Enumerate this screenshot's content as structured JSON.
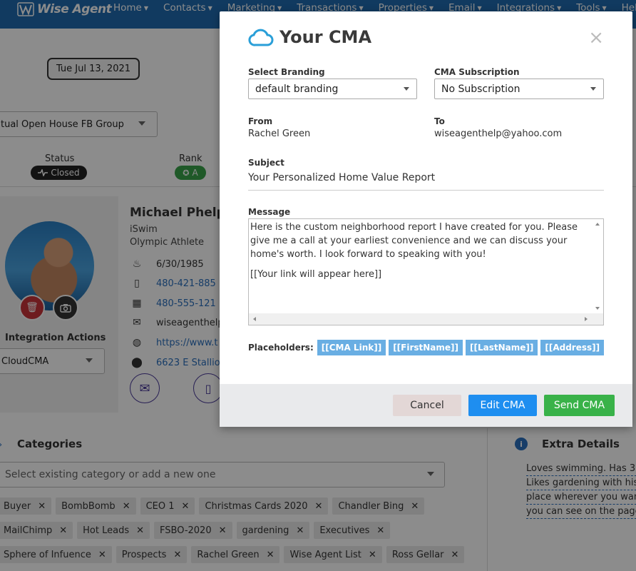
{
  "app": {
    "logo_text": "Wise Agent",
    "nav": [
      "Home",
      "Contacts",
      "Marketing",
      "Transactions",
      "Properties",
      "Email",
      "Integrations",
      "Tools",
      "Hel"
    ]
  },
  "background": {
    "date": "Tue Jul 13, 2021",
    "group_select": "tual Open House FB Group",
    "status_label": "Status",
    "status_value": "Closed",
    "rank_label": "Rank",
    "rank_value": "A",
    "contact": {
      "name": "Michael Phelp",
      "company": "iSwim",
      "title": "Olympic Athlete",
      "birthday": "6/30/1985",
      "phone1": "480-421-885",
      "phone2": "480-555-121",
      "email": "wiseagenthelp",
      "website": "https://www.t",
      "address": "6623 E Stallio"
    },
    "integration_actions": "Integration Actions",
    "integration_select": "CloudCMA",
    "categories_header": "Categories",
    "categories_placeholder": "Select existing category or add a new one",
    "category_rows": [
      [
        "Buyer",
        "BombBomb",
        "CEO 1",
        "Christmas Cards 2020",
        "Chandler Bing"
      ],
      [
        "MailChimp",
        "Hot Leads",
        "FSBO-2020",
        "gardening",
        "Executives"
      ],
      [
        "Sphere of Infuence",
        "Prospects",
        "Rachel Green",
        "Wise Agent List",
        "Ross Gellar"
      ]
    ],
    "extra_details_header": "Extra Details",
    "extra_details_lines": [
      "Loves swimming. Has 3",
      "Likes gardening with his",
      "place wherever you want",
      "you can see on the page"
    ]
  },
  "modal": {
    "title": "Your CMA",
    "close": "×",
    "branding_label": "Select Branding",
    "branding_value": "default branding",
    "subscription_label": "CMA Subscription",
    "subscription_value": "No Subscription",
    "from_label": "From",
    "from_value": "Rachel Green",
    "to_label": "To",
    "to_value": "wiseagenthelp@yahoo.com",
    "subject_label": "Subject",
    "subject_value": "Your Personalized Home Value Report",
    "message_label": "Message",
    "message_p1": "Here is the custom neighborhood report I have created for you. Please give me a call at your earliest convenience and we can discuss your home's worth. I look forward to speaking with you!",
    "message_p2": "[[Your link will appear here]]",
    "placeholders_label": "Placeholders:",
    "placeholders": [
      "[[CMA Link]]",
      "[[FirstName]]",
      "[[LastName]]",
      "[[Address]]"
    ],
    "cancel_label": "Cancel",
    "edit_label": "Edit CMA",
    "send_label": "Send CMA"
  },
  "colors": {
    "nav_bg": "#1f6bb0",
    "edit_btn": "#1e8ef0",
    "send_btn": "#39b249",
    "cancel_btn": "#e3d7d6",
    "placeholder_btn": "#69aee3",
    "cloud_icon": "#2a9fd8"
  }
}
